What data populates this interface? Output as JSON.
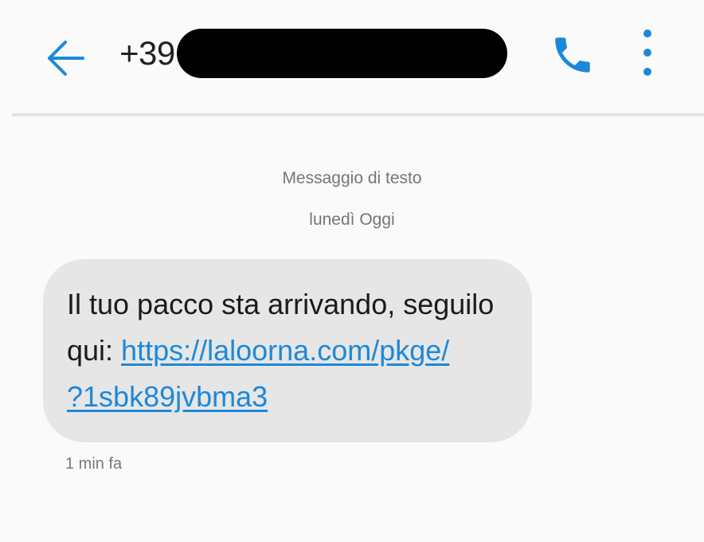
{
  "header": {
    "back_icon": "arrow-left-icon",
    "contact_prefix": "+39",
    "call_icon": "phone-icon",
    "more_icon": "more-vertical-icon"
  },
  "conversation": {
    "channel_label": "Messaggio di testo",
    "day_label": "lunedì Oggi",
    "message": {
      "text_before_link": "Il tuo pacco sta arrivando, seguilo qui: ",
      "link_line1": "https://laloorna.com/pkge/",
      "link_line2": "?1sbk89jvbma3",
      "timestamp": "1 min fa"
    }
  },
  "colors": {
    "accent": "#1e88d8",
    "background": "#fafafa",
    "bubble": "#e6e6e6"
  }
}
